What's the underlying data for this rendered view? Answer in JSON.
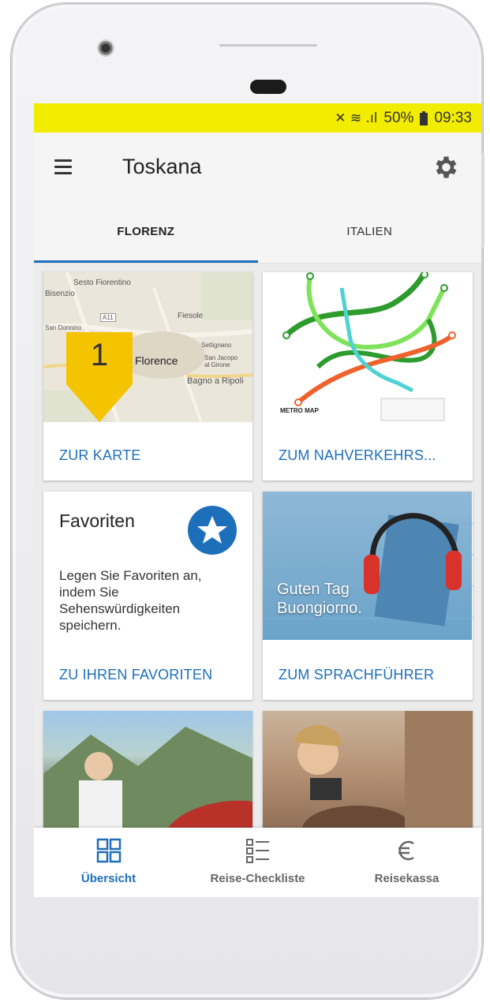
{
  "statusbar": {
    "signal_glyphs": "✕ ≋ .ıl",
    "battery": "50%",
    "time": "09:33"
  },
  "appbar": {
    "title": "Toskana"
  },
  "tabs": [
    {
      "label": "FLORENZ",
      "active": true
    },
    {
      "label": "ITALIEN",
      "active": false
    }
  ],
  "cards": {
    "map": {
      "link": "ZUR KARTE",
      "pin_number": "1",
      "map_labels": [
        "Sesto Fiorentino",
        "Bisenzio",
        "San Donnino",
        "Fiesole",
        "Settignano",
        "Florence",
        "San Jacopo al Girone",
        "Bagno a Ripoli",
        "A11"
      ]
    },
    "metro": {
      "link": "ZUM NAHVERKEHRS...",
      "map_title": "METRO MAP"
    },
    "favorites": {
      "title": "Favoriten",
      "text": "Legen Sie Favoriten an, indem Sie Sehenswürdigkeiten speichern.",
      "link": "ZU IHREN FAVORITEN"
    },
    "language": {
      "overlay_line1": "Guten Tag",
      "overlay_line2": "Buongiorno.",
      "link": "ZUM SPRACHFÜHRER"
    }
  },
  "bottomnav": [
    {
      "label": "Übersicht",
      "icon": "grid-icon",
      "active": true
    },
    {
      "label": "Reise-Checkliste",
      "icon": "checklist-icon",
      "active": false
    },
    {
      "label": "Reisekassa",
      "icon": "euro-icon",
      "active": false
    }
  ],
  "colors": {
    "accent": "#1e6fba",
    "statusbar": "#f2ec00",
    "pin": "#f5c400"
  }
}
